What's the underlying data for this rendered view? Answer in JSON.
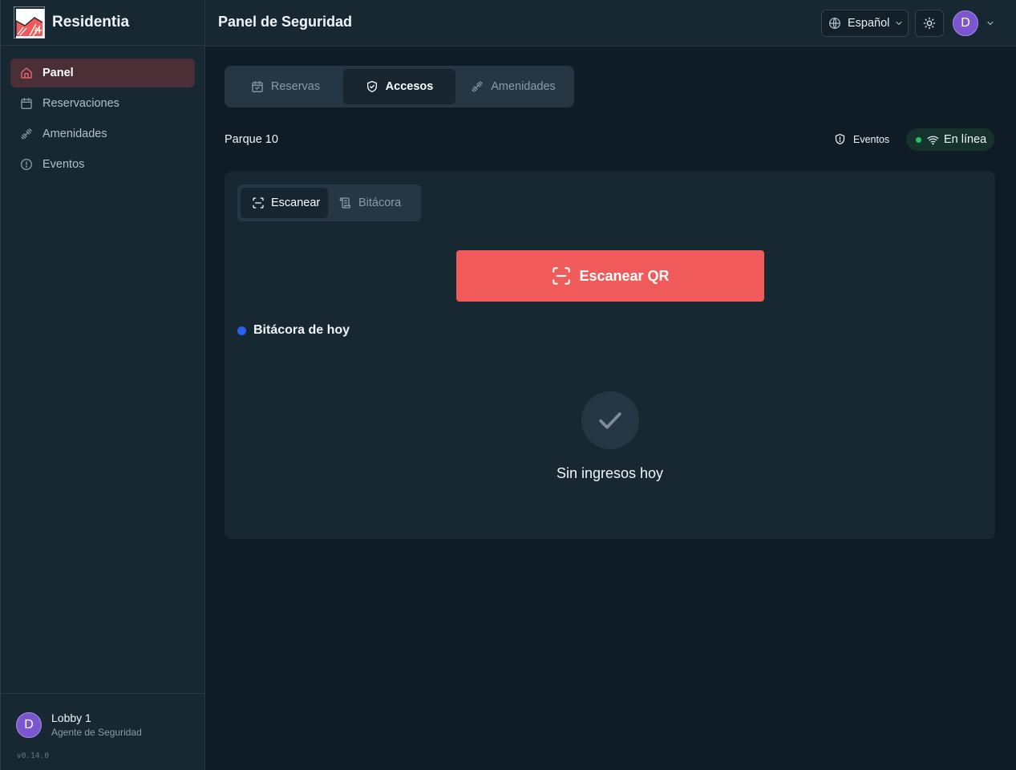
{
  "brand": {
    "name": "Residentia"
  },
  "sidebar": {
    "items": [
      {
        "label": "Panel",
        "icon": "home-icon",
        "active": true
      },
      {
        "label": "Reservaciones",
        "icon": "calendar-icon"
      },
      {
        "label": "Amenidades",
        "icon": "dumbbell-icon"
      },
      {
        "label": "Eventos",
        "icon": "alert-circle-icon"
      }
    ],
    "user": {
      "initial": "D",
      "name": "Lobby 1",
      "role": "Agente de Seguridad"
    },
    "version": "v0.14.0"
  },
  "header": {
    "title": "Panel de Seguridad",
    "language": "Español",
    "user_initial": "D"
  },
  "tabs": [
    {
      "label": "Reservas",
      "icon": "calendar-icon"
    },
    {
      "label": "Accesos",
      "icon": "shield-icon",
      "active": true
    },
    {
      "label": "Amenidades",
      "icon": "dumbbell-icon"
    }
  ],
  "location": "Parque 10",
  "events_link": "Eventos",
  "status": {
    "label": "En línea",
    "color": "#22c55e"
  },
  "subtabs": [
    {
      "label": "Escanear",
      "icon": "scan-icon",
      "active": true
    },
    {
      "label": "Bitácora",
      "icon": "scroll-icon"
    }
  ],
  "scan_button": {
    "label": "Escanear QR",
    "color": "#f05a5a"
  },
  "log": {
    "title": "Bitácora de hoy",
    "dot_color": "#2563eb",
    "empty_text": "Sin ingresos hoy"
  },
  "colors": {
    "accent": "#f05a5a",
    "background": "#0f1b25",
    "panel": "#182833"
  }
}
